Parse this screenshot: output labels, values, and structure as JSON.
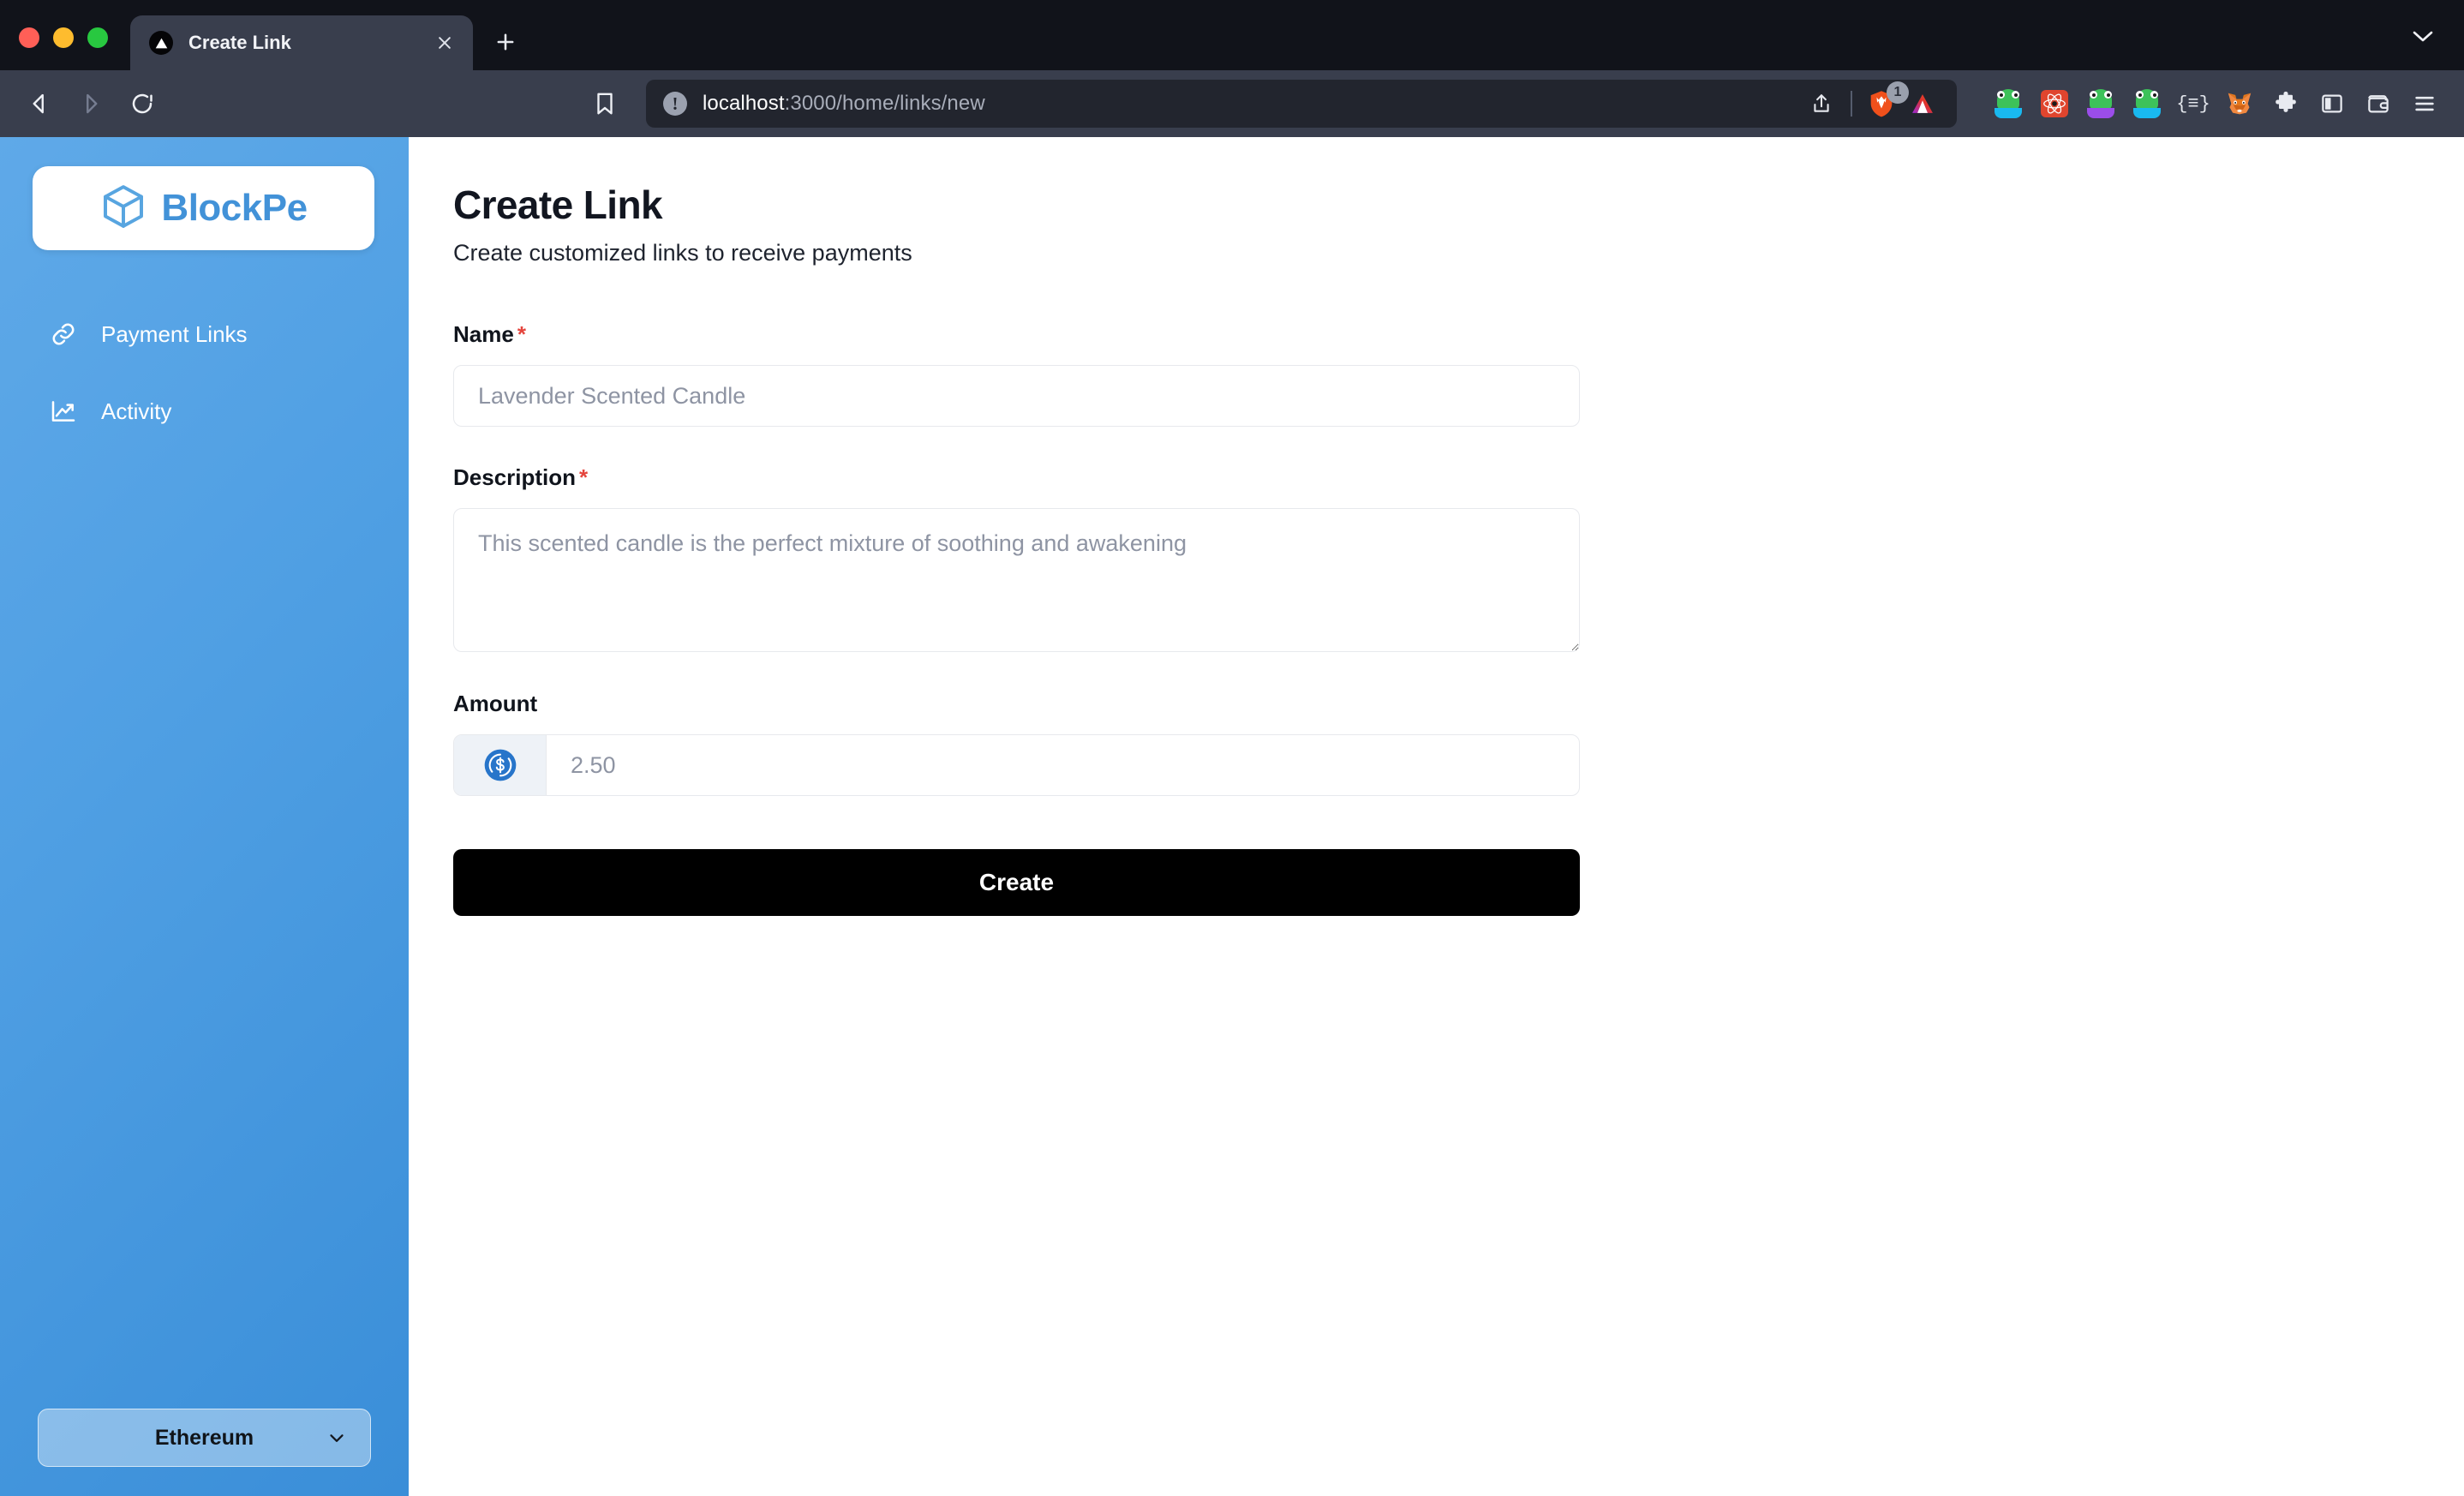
{
  "browser": {
    "window_controls": [
      "close",
      "minimize",
      "maximize"
    ],
    "tab": {
      "title": "Create Link",
      "favicon": "vercel-triangle-icon",
      "close_label": "×"
    },
    "new_tab_label": "+",
    "tab_search_icon": "chevron-down-icon",
    "nav": {
      "back_icon": "back-arrow-icon",
      "forward_icon": "forward-arrow-icon",
      "reload_icon": "reload-icon",
      "bookmark_icon": "bookmark-icon"
    },
    "omnibox": {
      "security_icon": "info-circle-icon",
      "host": "localhost",
      "path": ":3000/home/links/new",
      "full_url": "localhost:3000/home/links/new",
      "share_icon": "share-icon",
      "shields_icon": "brave-shields-lion-icon",
      "shields_badge": "1",
      "leo_icon": "brave-leo-triangle-icon"
    },
    "extensions": [
      {
        "name": "rabby-wallet-icon",
        "type": "frog",
        "base": "blue"
      },
      {
        "name": "react-devtools-icon",
        "type": "react"
      },
      {
        "name": "rabby-wallet-purple-icon",
        "type": "frog",
        "base": "purple"
      },
      {
        "name": "rabby-wallet-blue-icon",
        "type": "frog",
        "base": "blue"
      },
      {
        "name": "json-viewer-icon",
        "type": "json",
        "glyph": "{≡}"
      },
      {
        "name": "metamask-fox-icon",
        "type": "fox"
      },
      {
        "name": "extensions-puzzle-icon",
        "type": "puzzle"
      },
      {
        "name": "sidebar-panel-icon",
        "type": "panel"
      },
      {
        "name": "brave-wallet-icon",
        "type": "wallet"
      },
      {
        "name": "browser-menu-icon",
        "type": "hamburger"
      }
    ]
  },
  "sidebar": {
    "logo": {
      "text": "BlockPe",
      "icon": "cube-icon",
      "color": "#4292d8"
    },
    "items": [
      {
        "label": "Payment Links",
        "icon": "link-chain-icon"
      },
      {
        "label": "Activity",
        "icon": "trending-up-chart-icon"
      }
    ],
    "network_selector": {
      "value": "Ethereum",
      "chevron_icon": "chevron-down-icon"
    }
  },
  "main": {
    "title": "Create Link",
    "subtitle": "Create customized links to receive payments",
    "form": {
      "name": {
        "label": "Name",
        "required_mark": "*",
        "value": "",
        "placeholder": "Lavender Scented Candle"
      },
      "description": {
        "label": "Description",
        "required_mark": "*",
        "value": "",
        "placeholder": "This scented candle is the perfect mixture of soothing and awakening"
      },
      "amount": {
        "label": "Amount",
        "required_mark": "",
        "value": "",
        "placeholder": "2.50",
        "currency_icon": "usdc-coin-icon"
      },
      "submit_label": "Create"
    }
  },
  "colors": {
    "brand_blue": "#4292d8",
    "sidebar_gradient_from": "#5fa9e8",
    "sidebar_gradient_to": "#3a8ed8",
    "required_red": "#e4453d",
    "button_black": "#000000",
    "usdc_blue": "#2775ca"
  }
}
